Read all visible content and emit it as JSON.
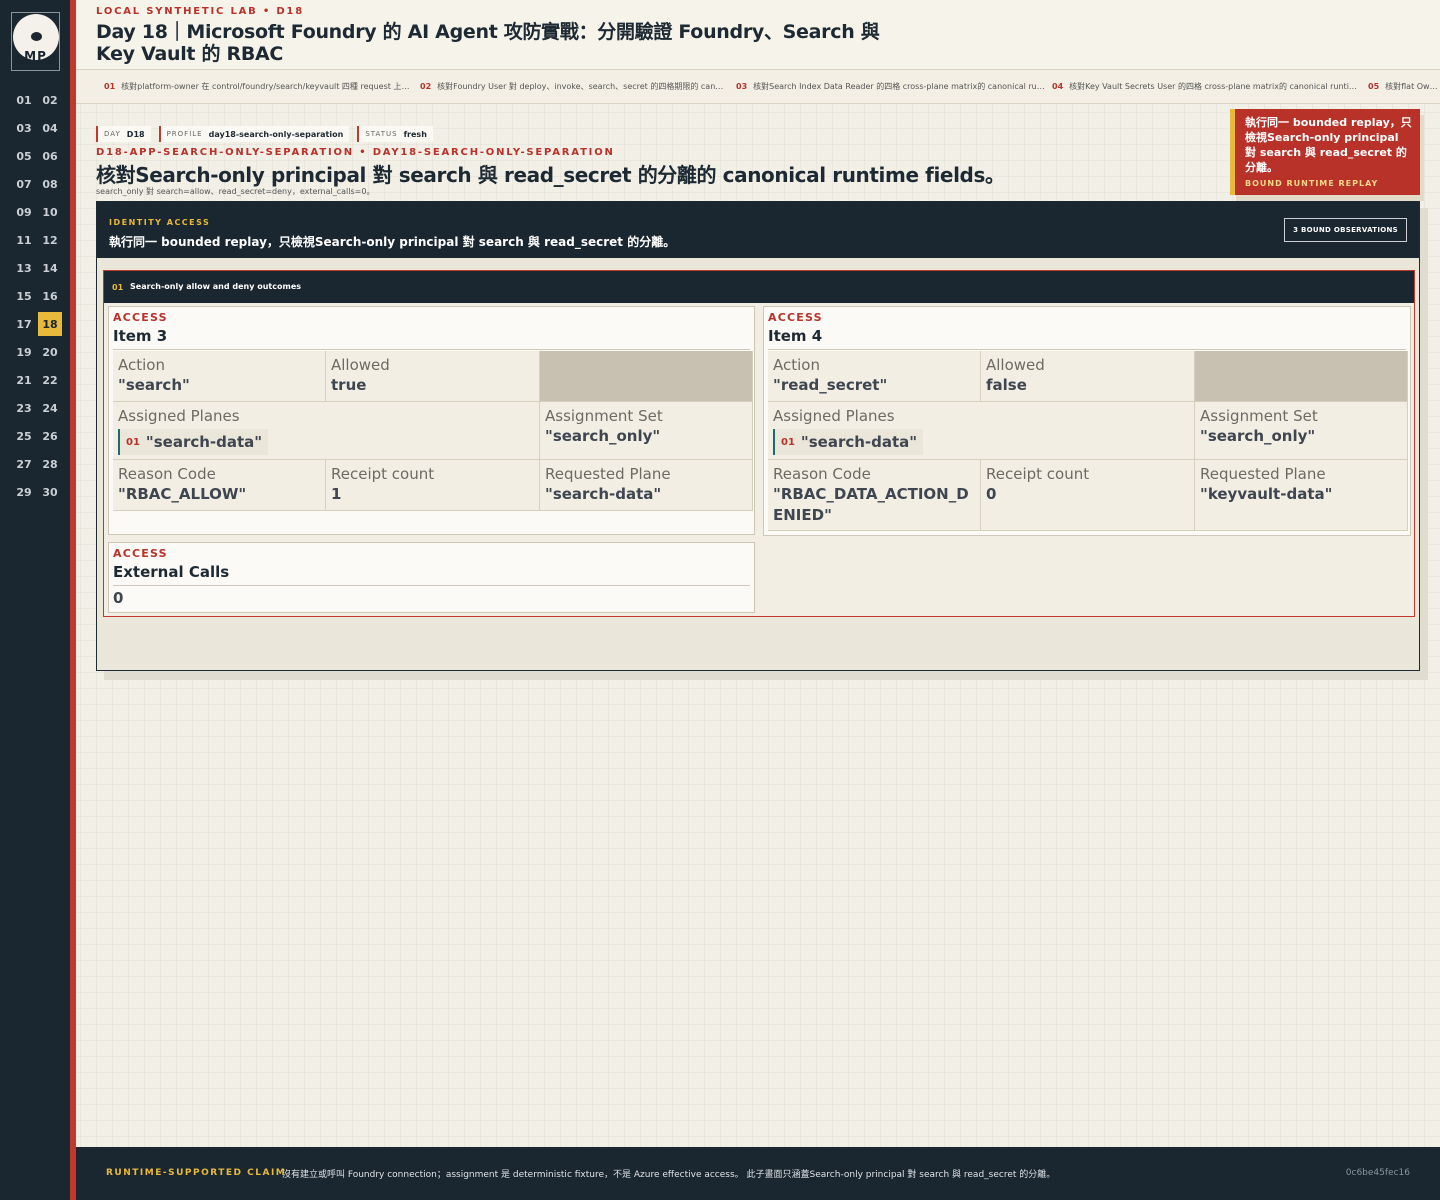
{
  "sidebar": {
    "logo_text": "MP",
    "days": [
      "01",
      "02",
      "03",
      "04",
      "05",
      "06",
      "07",
      "08",
      "09",
      "10",
      "11",
      "12",
      "13",
      "14",
      "15",
      "16",
      "17",
      "18",
      "19",
      "20",
      "21",
      "22",
      "23",
      "24",
      "25",
      "26",
      "27",
      "28",
      "29",
      "30"
    ],
    "active_day": "18"
  },
  "header": {
    "kicker": "LOCAL SYNTHETIC LAB  •  D18",
    "title": "Day 18｜Microsoft Foundry 的 AI Agent 攻防實戰：分開驗證 Foundry、Search 與 Key Vault 的 RBAC"
  },
  "crumbs": [
    {
      "n": "01",
      "text": "核對platform-owner 在 control/foundry/search/keyvault 四種 request 上的…"
    },
    {
      "n": "02",
      "text": "核對Foundry User 對 deploy、invoke、search、secret 的四格期限的 can…"
    },
    {
      "n": "03",
      "text": "核對Search Index Data Reader 的四格 cross-plane matrix的 canonical ru…"
    },
    {
      "n": "04",
      "text": "核對Key Vault Secrets User 的四格 cross-plane matrix的 canonical runti…"
    },
    {
      "n": "05",
      "text": "核對flat Owner…"
    }
  ],
  "tags": [
    {
      "k": "DAY",
      "v": "D18"
    },
    {
      "k": "PROFILE",
      "v": "day18-search-only-separation"
    },
    {
      "k": "STATUS",
      "v": "fresh"
    }
  ],
  "page": {
    "slug": "D18-APP-SEARCH-ONLY-SEPARATION  •  DAY18-SEARCH-ONLY-SEPARATION",
    "heading": "核對Search-only principal 對 search 與 read_secret 的分離的 canonical runtime fields。",
    "subline": "search_only 對 search=allow、read_secret=deny，external_calls=0。"
  },
  "callout": {
    "text": "執行同一 bounded replay，只檢視Search-only principal 對 search 與 read_secret 的分離。",
    "label": "BOUND RUNTIME REPLAY"
  },
  "panel": {
    "kicker": "IDENTITY ACCESS",
    "title": "執行同一 bounded replay，只檢視Search-only principal 對 search 與 read_secret 的分離。",
    "badge": "3 BOUND OBSERVATIONS"
  },
  "section": {
    "num": "01",
    "title": "Search-only allow and deny outcomes"
  },
  "cards": [
    {
      "kicker": "ACCESS",
      "title": "Item 3",
      "action_label": "Action",
      "action": "\"search\"",
      "allowed_label": "Allowed",
      "allowed": "true",
      "planes_label": "Assigned Planes",
      "plane_num": "01",
      "plane": "\"search-data\"",
      "set_label": "Assignment Set",
      "set": "\"search_only\"",
      "reason_label": "Reason Code",
      "reason": "\"RBAC_ALLOW\"",
      "receipt_label": "Receipt count",
      "receipt": "1",
      "req_label": "Requested Plane",
      "req": "\"search-data\""
    },
    {
      "kicker": "ACCESS",
      "title": "Item 4",
      "action_label": "Action",
      "action": "\"read_secret\"",
      "allowed_label": "Allowed",
      "allowed": "false",
      "planes_label": "Assigned Planes",
      "plane_num": "01",
      "plane": "\"search-data\"",
      "set_label": "Assignment Set",
      "set": "\"search_only\"",
      "reason_label": "Reason Code",
      "reason": "\"RBAC_DATA_ACTION_DENIED\"",
      "receipt_label": "Receipt count",
      "receipt": "0",
      "req_label": "Requested Plane",
      "req": "\"keyvault-data\""
    }
  ],
  "external": {
    "kicker": "ACCESS",
    "title": "External Calls",
    "value": "0"
  },
  "footer": {
    "kicker": "RUNTIME-SUPPORTED CLAIM",
    "text": "沒有建立或呼叫 Foundry connection；assignment 是 deterministic fixture，不是 Azure effective access。 此子畫面只涵蓋Search-only principal 對 search 與 read_secret 的分離。",
    "hash": "0c6be45fec16"
  },
  "colors": {
    "sidebar": "#1a2630",
    "accent_red": "#b8322a",
    "accent_gold": "#e8b93a",
    "paper": "#f2efe6"
  }
}
